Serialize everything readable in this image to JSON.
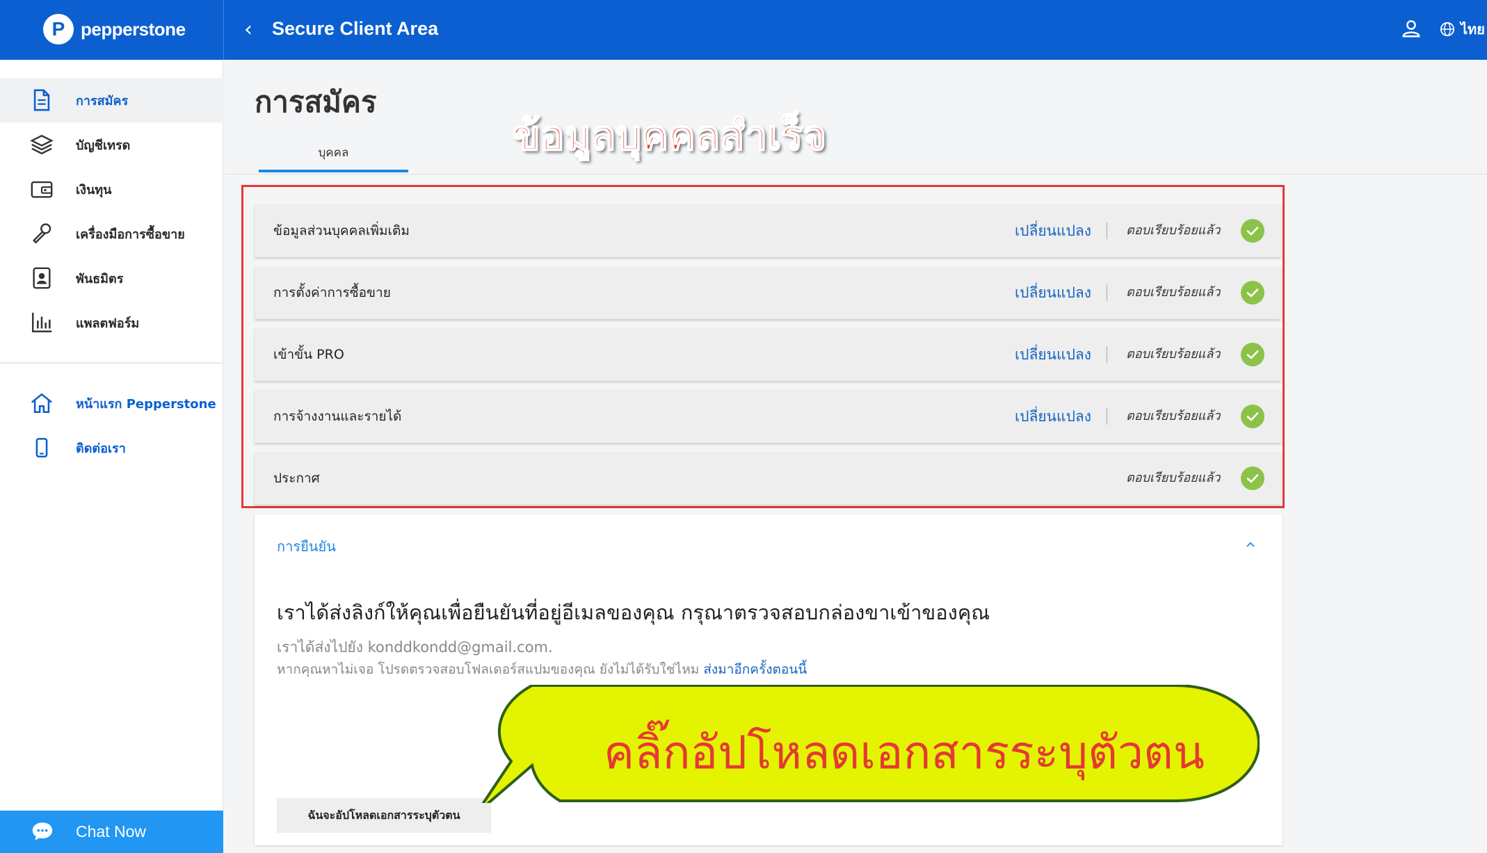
{
  "header": {
    "logo_text": "pepperstone",
    "logo_glyph": "P",
    "title": "Secure Client Area",
    "language": "ไทย",
    "colors": {
      "bar": "#0b5fd1"
    }
  },
  "sidebar": {
    "items": [
      {
        "label": "การสมัคร",
        "icon": "document-icon",
        "active": true
      },
      {
        "label": "บัญชีเทรด",
        "icon": "layers-icon"
      },
      {
        "label": "เงินทุน",
        "icon": "wallet-icon"
      },
      {
        "label": "เครื่องมือการซื้อขาย",
        "icon": "tools-icon"
      },
      {
        "label": "พันธมิตร",
        "icon": "contact-card-icon"
      },
      {
        "label": "แพลตฟอร์ม",
        "icon": "bar-chart-icon"
      }
    ],
    "links": [
      {
        "label": "หน้าแรก Pepperstone",
        "icon": "home-icon"
      },
      {
        "label": "ติดต่อเรา",
        "icon": "phone-icon"
      }
    ],
    "chat_label": "Chat Now"
  },
  "main": {
    "page_title": "การสมัคร",
    "tabs": [
      {
        "label": "บุคคล",
        "active": true
      }
    ],
    "overlay_title": "ข้อมูลบุคคลสำเร็จ",
    "sections": [
      {
        "label": "ข้อมูลส่วนบุคคลเพิ่มเติม",
        "change_label": "เปลี่ยนแปลง",
        "status": "ตอบเรียบร้อยแล้ว"
      },
      {
        "label": "การตั้งค่าการซื้อขาย",
        "change_label": "เปลี่ยนแปลง",
        "status": "ตอบเรียบร้อยแล้ว"
      },
      {
        "label": "เข้าขั้น PRO",
        "change_label": "เปลี่ยนแปลง",
        "status": "ตอบเรียบร้อยแล้ว"
      },
      {
        "label": "การจ้างงานและรายได้",
        "change_label": "เปลี่ยนแปลง",
        "status": "ตอบเรียบร้อยแล้ว"
      },
      {
        "label": "ประกาศ",
        "status": "ตอบเรียบร้อยแล้ว"
      }
    ],
    "verification": {
      "header": "การยืนยัน",
      "message": "เราได้ส่งลิงก์ให้คุณเพื่อยืนยันที่อยู่อีเมลของคุณ กรุณาตรวจสอบกล่องขาเข้าของคุณ",
      "sent_to": "เราได้ส่งไปยัง konddkondd@gmail.com.",
      "not_found": "หากคุณหาไม่เจอ โปรดตรวจสอบโฟลเดอร์สแปมของคุณ ยังไม่ได้รับใช่ไหม ",
      "resend_link": "ส่งมาอีกครั้งตอนนี้",
      "upload_button": "ฉันจะอัปโหลดเอกสารระบุตัวตน"
    },
    "callout": "คลิ๊กอัปโหลดเอกสารระบุตัวตน"
  }
}
